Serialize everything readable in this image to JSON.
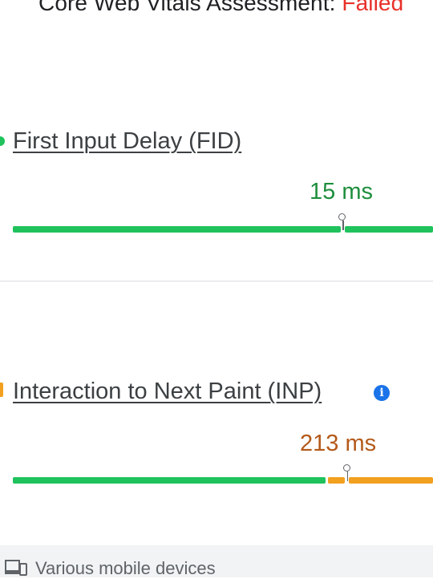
{
  "header": {
    "title_prefix": "Core Web Vitals Assessment: ",
    "status": "Failed"
  },
  "metrics": [
    {
      "name": "First Input Delay (FID)",
      "value": "15 ms",
      "rating": "good",
      "rating_color": "#1e8e3e",
      "segments": [
        {
          "color": "#1fc25c",
          "from": 0.0,
          "to": 0.78
        },
        {
          "color": "#1fc25c",
          "from": 0.79,
          "to": 1.0
        }
      ],
      "marker_position": 0.785
    },
    {
      "name": "Interaction to Next Paint (INP)",
      "value": "213 ms",
      "rating": "needs-improvement",
      "rating_color": "#b45a1a",
      "segments": [
        {
          "color": "#1fc25c",
          "from": 0.0,
          "to": 0.745
        },
        {
          "color": "#f2a01f",
          "from": 0.75,
          "to": 0.79
        },
        {
          "color": "#f2a01f",
          "from": 0.8,
          "to": 1.0
        }
      ],
      "marker_position": 0.795
    }
  ],
  "colors": {
    "good": "#1fc25c",
    "needs_improvement": "#f2a01f",
    "poor": "#e8312a",
    "info": "#1a73e8"
  },
  "footer": {
    "icon": "devices-icon",
    "label": "Various mobile devices"
  }
}
